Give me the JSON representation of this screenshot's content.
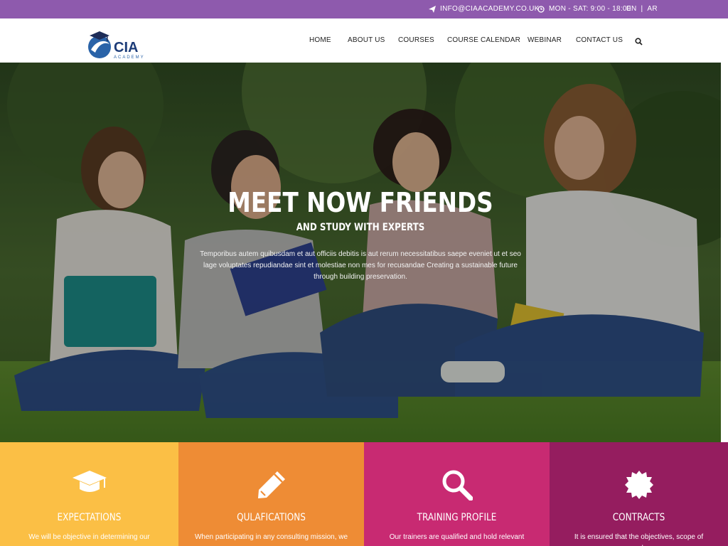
{
  "topbar": {
    "email": "INFO@CIAACADEMY.CO.UK",
    "hours": "MON - SAT: 9:00 - 18:00",
    "lang_en": "EN",
    "lang_sep": "|",
    "lang_ar": "AR",
    "background": "#8e5aad"
  },
  "logo": {
    "name": "CIA",
    "tagline": "ACADEMY"
  },
  "nav": {
    "items": [
      {
        "label": "HOME"
      },
      {
        "label": "ABOUT US"
      },
      {
        "label": "COURSES"
      },
      {
        "label": "COURSE CALENDAR"
      },
      {
        "label": "WEBINAR"
      },
      {
        "label": "CONTACT US"
      }
    ],
    "search_icon": "search-icon"
  },
  "hero": {
    "title": "MEET NOW FRIENDS",
    "subtitle": "AND STUDY WITH EXPERTS",
    "text": "Temporibus autem quibusdam et aut officiis debitis is aut rerum necessitatibus saepe eveniet ut et seo lage voluptates repudiandae sint et molestiae non mes for recusandae Creating a sustainable future through building preservation."
  },
  "features": [
    {
      "title": "EXPECTATIONS",
      "text": "We will be objective in determining our",
      "icon": "graduation-cap-icon",
      "color": "#fbbf45"
    },
    {
      "title": "QULAFICATIONS",
      "text": "When participating in any consulting mission, we",
      "icon": "pencil-icon",
      "color": "#ee8c35"
    },
    {
      "title": "TRAINING PROFILE",
      "text": "Our trainers are qualified and hold relevant",
      "icon": "magnifier-icon",
      "color": "#c82a72"
    },
    {
      "title": "CONTRACTS",
      "text": "It is ensured that the objectives, scope of work,",
      "icon": "badge-icon",
      "color": "#951d5f"
    }
  ]
}
